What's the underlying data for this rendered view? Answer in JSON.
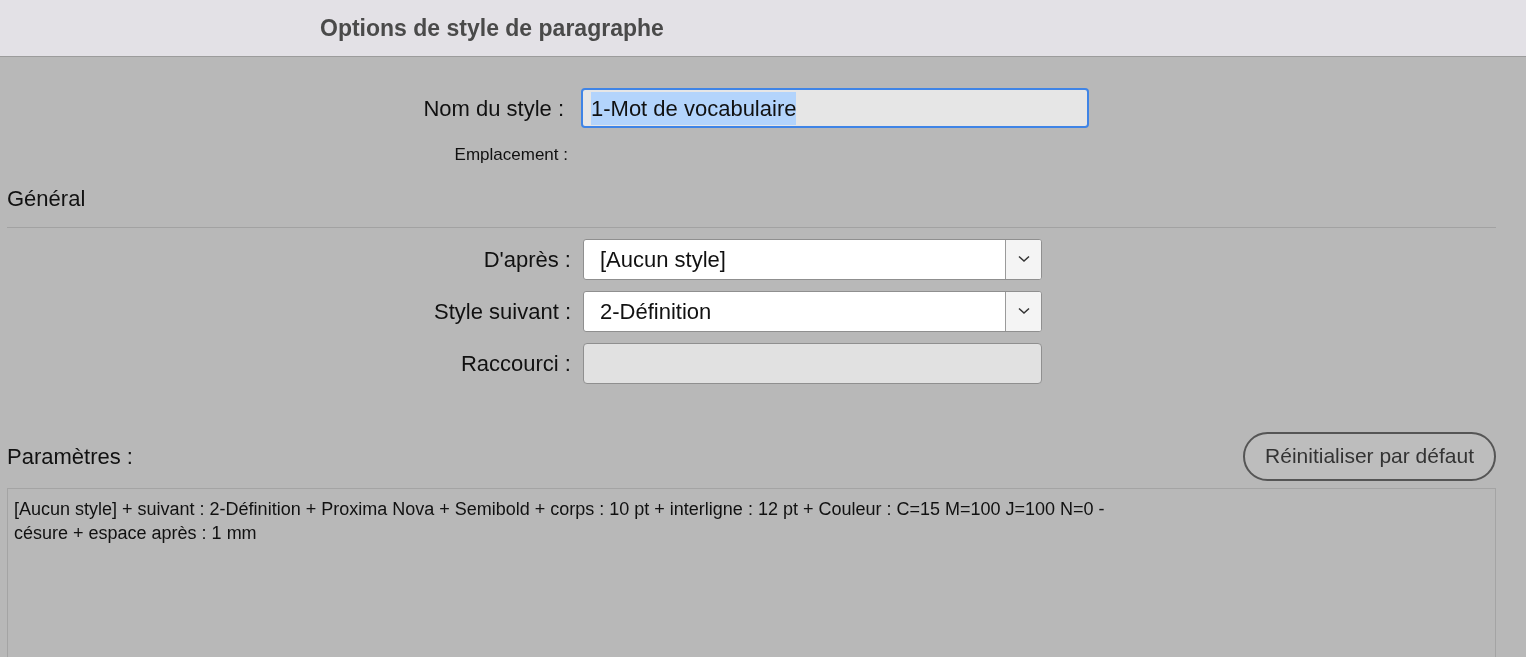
{
  "window": {
    "title": "Options de style de paragraphe"
  },
  "style_name": {
    "label": "Nom du style :",
    "value": "1-Mot de vocabulaire",
    "selected": true
  },
  "location": {
    "label": "Emplacement :"
  },
  "section": {
    "title": "Général"
  },
  "fields": [
    {
      "kind": "dropdown",
      "label": "D'après :",
      "value": "[Aucun style]"
    },
    {
      "kind": "dropdown",
      "label": "Style suivant :",
      "value": "2-Définition"
    },
    {
      "kind": "text",
      "label": "Raccourci :"
    }
  ],
  "parameters": {
    "label": "Paramètres :",
    "reset_button": "Réinitialiser par défaut",
    "summary": "[Aucun style] + suivant : 2-Définition + Proxima Nova + Semibold + corps : 10 pt + interligne : 12 pt + Couleur : C=15 M=100 J=100 N=0 - césure + espace après : 1 mm"
  }
}
